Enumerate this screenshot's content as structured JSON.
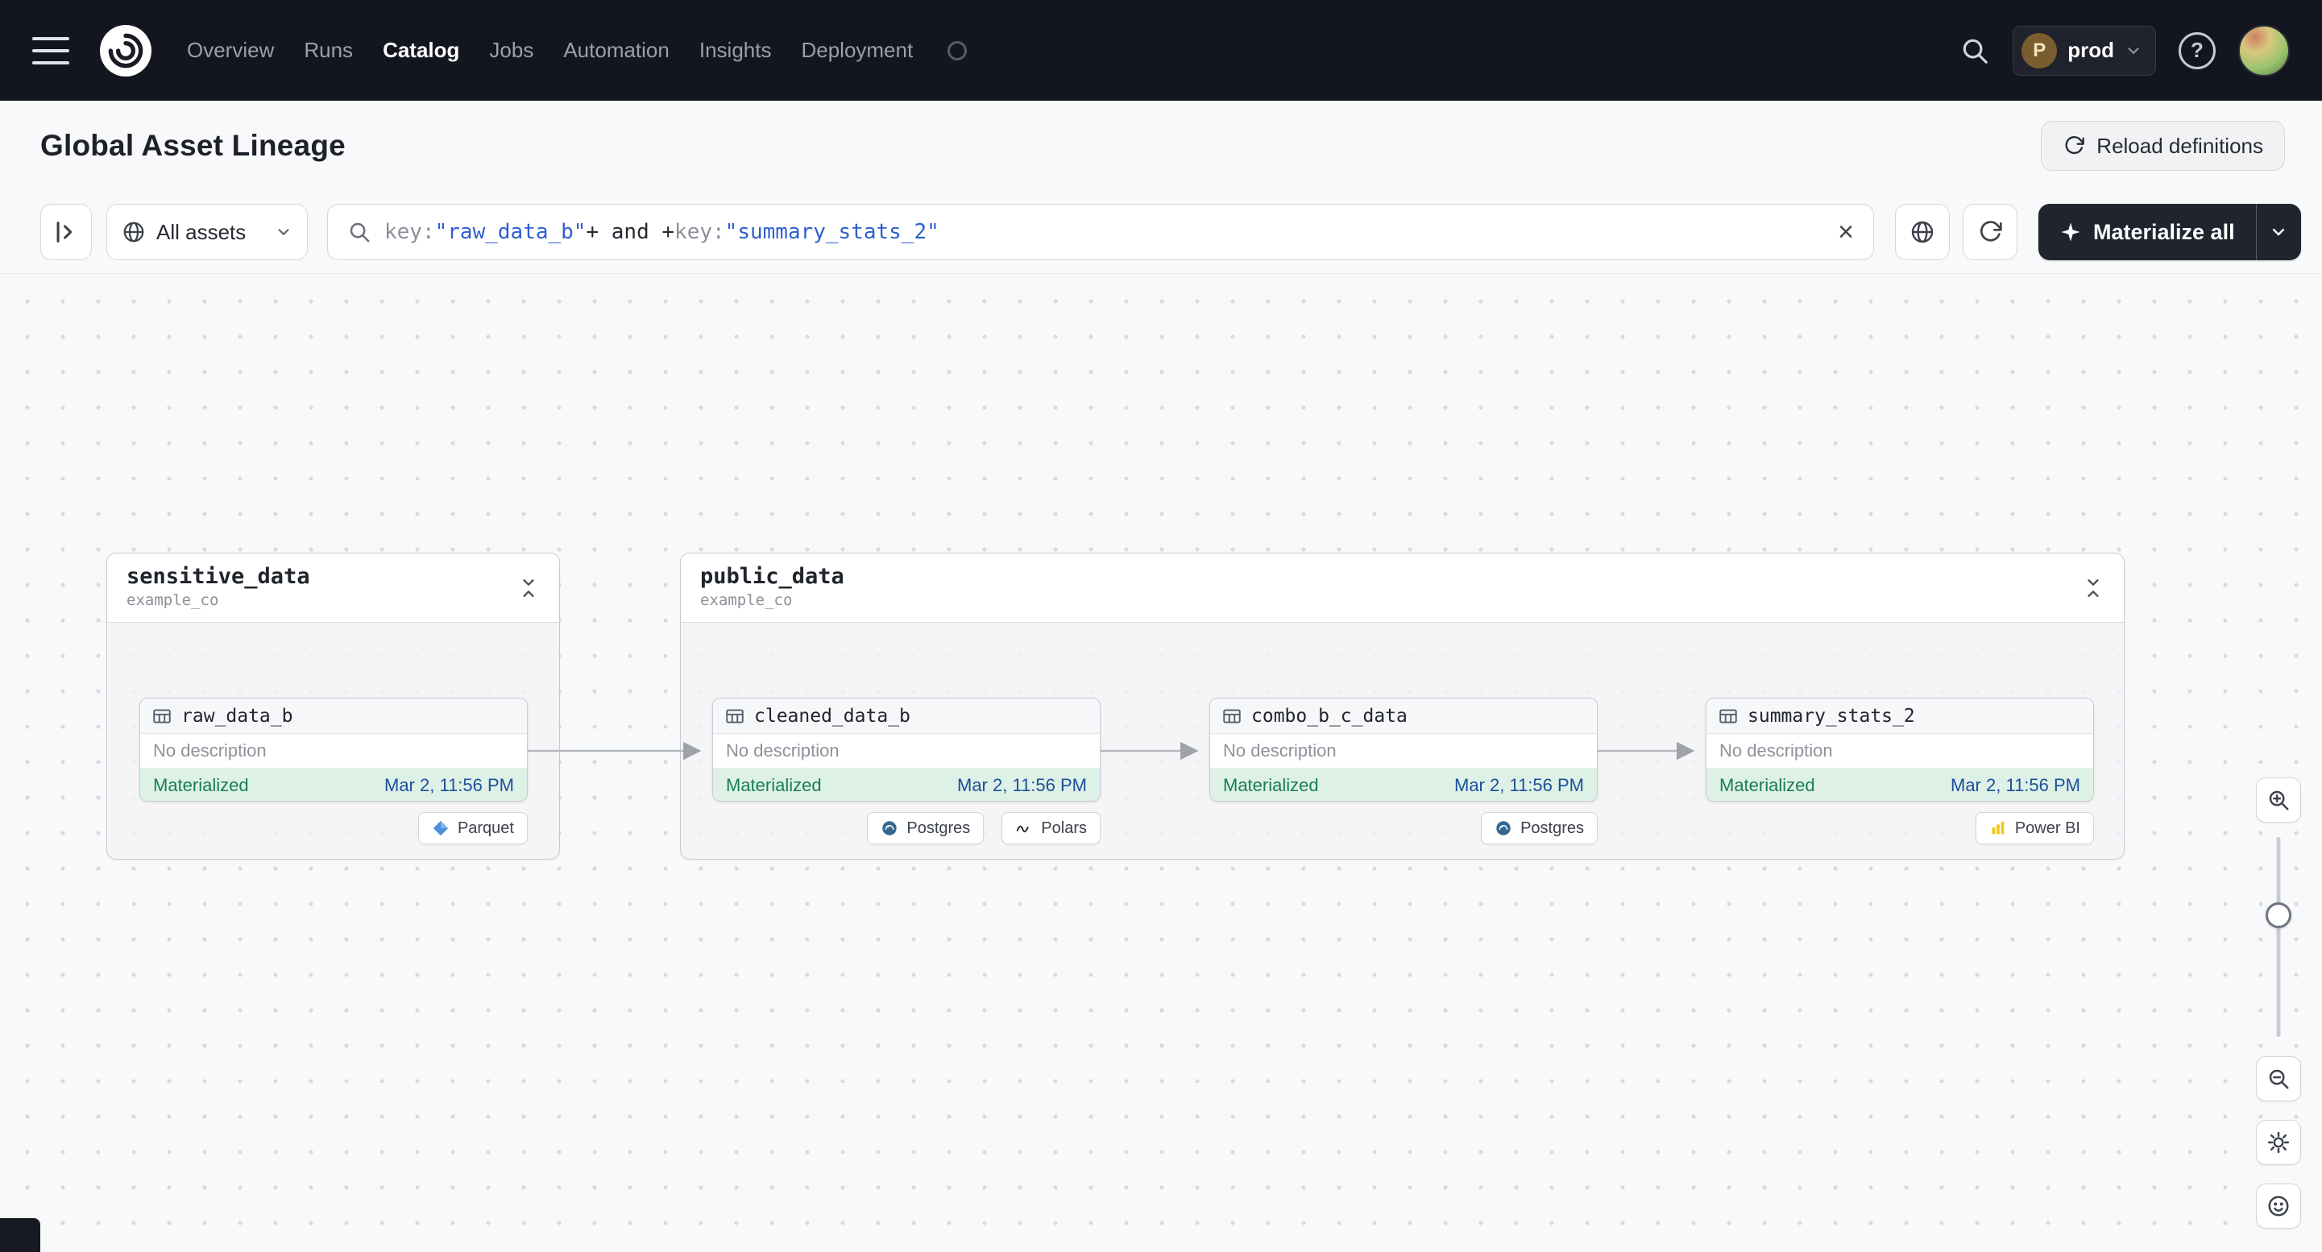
{
  "colors": {
    "navbar_bg": "#14161f",
    "accent_blue": "#2e5fd0",
    "status_green_text": "#1a7d4f",
    "status_green_bg": "#def1e6",
    "timestamp_blue": "#1d4f9c",
    "materialize_button_bg": "#20242f",
    "postgres_blue": "#336791",
    "powerbi_yellow": "#f2c811",
    "parquet_blue": "#4a90d9"
  },
  "navbar": {
    "items": [
      {
        "label": "Overview"
      },
      {
        "label": "Runs"
      },
      {
        "label": "Catalog"
      },
      {
        "label": "Jobs"
      },
      {
        "label": "Automation"
      },
      {
        "label": "Insights"
      },
      {
        "label": "Deployment"
      }
    ],
    "env": {
      "initial": "P",
      "label": "prod"
    },
    "help": "?"
  },
  "header": {
    "title": "Global Asset Lineage",
    "reload_label": "Reload definitions"
  },
  "toolbar": {
    "scope_label": "All assets",
    "search": {
      "t1": "key:",
      "t2": "\"raw_data_b\"",
      "t3": "+ and +",
      "t4": "key:",
      "t5": "\"summary_stats_2\"",
      "clear": "×"
    },
    "materialize_label": "Materialize all"
  },
  "graph": {
    "groups": [
      {
        "name": "sensitive_data",
        "subtitle": "example_co"
      },
      {
        "name": "public_data",
        "subtitle": "example_co"
      }
    ],
    "nodes": [
      {
        "name": "raw_data_b",
        "description": "No description",
        "status": "Materialized",
        "timestamp": "Mar 2, 11:56 PM",
        "tags": [
          "Parquet"
        ]
      },
      {
        "name": "cleaned_data_b",
        "description": "No description",
        "status": "Materialized",
        "timestamp": "Mar 2, 11:56 PM",
        "tags": [
          "Postgres",
          "Polars"
        ]
      },
      {
        "name": "combo_b_c_data",
        "description": "No description",
        "status": "Materialized",
        "timestamp": "Mar 2, 11:56 PM",
        "tags": [
          "Postgres"
        ]
      },
      {
        "name": "summary_stats_2",
        "description": "No description",
        "status": "Materialized",
        "timestamp": "Mar 2, 11:56 PM",
        "tags": [
          "Power BI"
        ]
      }
    ]
  }
}
